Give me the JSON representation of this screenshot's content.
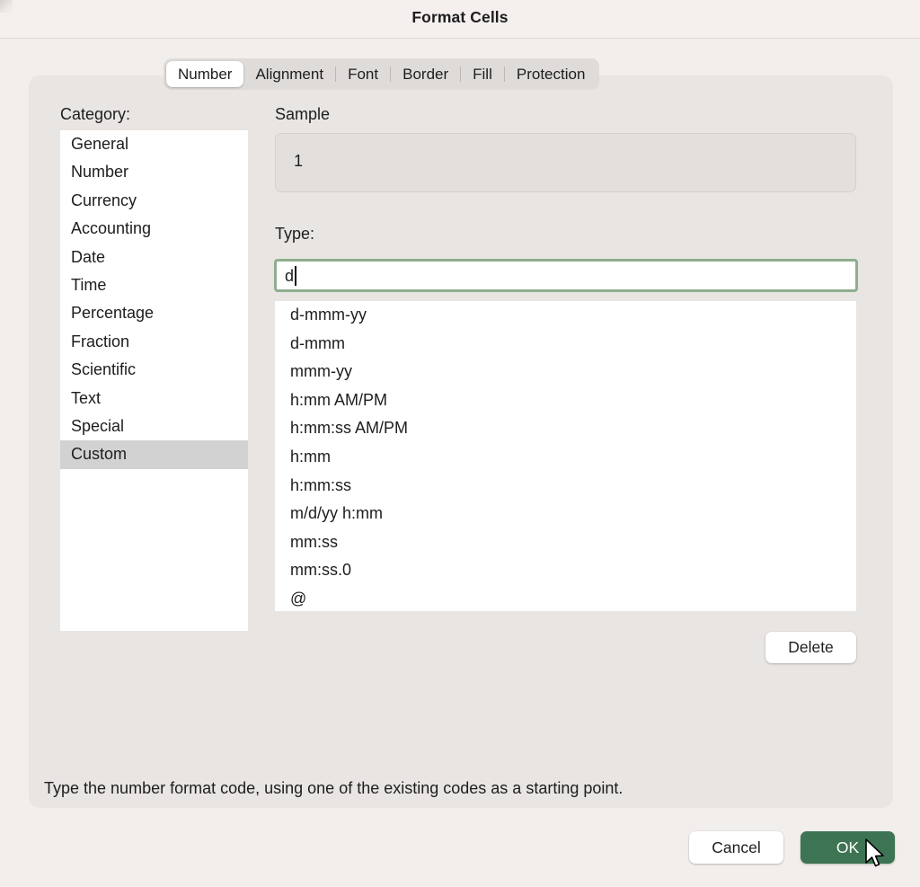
{
  "window": {
    "title": "Format Cells"
  },
  "tabs": [
    {
      "label": "Number",
      "selected": true
    },
    {
      "label": "Alignment",
      "selected": false
    },
    {
      "label": "Font",
      "selected": false
    },
    {
      "label": "Border",
      "selected": false
    },
    {
      "label": "Fill",
      "selected": false
    },
    {
      "label": "Protection",
      "selected": false
    }
  ],
  "category": {
    "label": "Category:",
    "selected": "Custom",
    "items": [
      "General",
      "Number",
      "Currency",
      "Accounting",
      "Date",
      "Time",
      "Percentage",
      "Fraction",
      "Scientific",
      "Text",
      "Special",
      "Custom"
    ]
  },
  "sample": {
    "label": "Sample",
    "value": "1"
  },
  "type": {
    "label": "Type:",
    "value": "d",
    "placeholder": ""
  },
  "format_list": {
    "items": [
      "d-mmm-yy",
      "d-mmm",
      "mmm-yy",
      "h:mm AM/PM",
      "h:mm:ss AM/PM",
      "h:mm",
      "h:mm:ss",
      "m/d/yy h:mm",
      "mm:ss",
      "mm:ss.0",
      "@"
    ]
  },
  "buttons": {
    "delete": "Delete",
    "cancel": "Cancel",
    "ok": "OK"
  },
  "help_text": "Type the number format code, using one of the existing codes as a starting point.",
  "colors": {
    "accent_green": "#3d7453",
    "focus_border": "#8fae8f",
    "titlebar_bg": "#f5f0ee",
    "panel_bg": "#e9e5e3",
    "window_bg": "#f2eeec",
    "list_bg": "#ffffff",
    "selection_bg": "#d2d2d2"
  }
}
